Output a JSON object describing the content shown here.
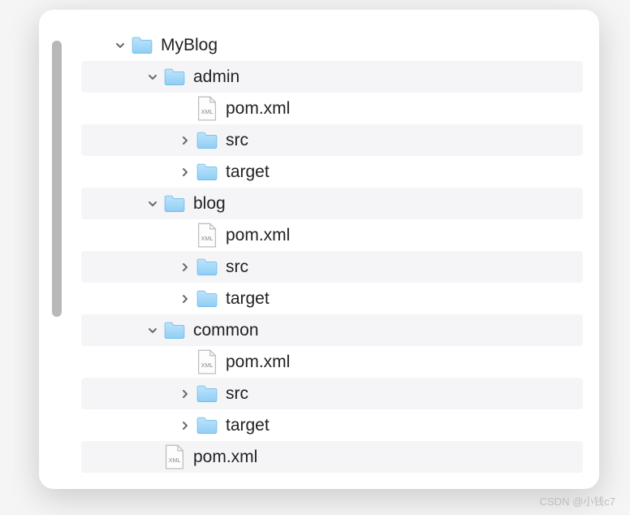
{
  "tree": [
    {
      "indent": 0,
      "disclosure": "down",
      "icon": "folder",
      "label": "MyBlog",
      "stripe": false
    },
    {
      "indent": 1,
      "disclosure": "down",
      "icon": "folder",
      "label": "admin",
      "stripe": true
    },
    {
      "indent": 2,
      "disclosure": "none",
      "icon": "xml",
      "label": "pom.xml",
      "stripe": false
    },
    {
      "indent": 2,
      "disclosure": "right",
      "icon": "folder",
      "label": "src",
      "stripe": true
    },
    {
      "indent": 2,
      "disclosure": "right",
      "icon": "folder",
      "label": "target",
      "stripe": false
    },
    {
      "indent": 1,
      "disclosure": "down",
      "icon": "folder",
      "label": "blog",
      "stripe": true
    },
    {
      "indent": 2,
      "disclosure": "none",
      "icon": "xml",
      "label": "pom.xml",
      "stripe": false
    },
    {
      "indent": 2,
      "disclosure": "right",
      "icon": "folder",
      "label": "src",
      "stripe": true
    },
    {
      "indent": 2,
      "disclosure": "right",
      "icon": "folder",
      "label": "target",
      "stripe": false
    },
    {
      "indent": 1,
      "disclosure": "down",
      "icon": "folder",
      "label": "common",
      "stripe": true
    },
    {
      "indent": 2,
      "disclosure": "none",
      "icon": "xml",
      "label": "pom.xml",
      "stripe": false
    },
    {
      "indent": 2,
      "disclosure": "right",
      "icon": "folder",
      "label": "src",
      "stripe": true
    },
    {
      "indent": 2,
      "disclosure": "right",
      "icon": "folder",
      "label": "target",
      "stripe": false
    },
    {
      "indent": 1,
      "disclosure": "none",
      "icon": "xml",
      "label": "pom.xml",
      "stripe": true
    }
  ],
  "watermark": "CSDN @小钱c7"
}
